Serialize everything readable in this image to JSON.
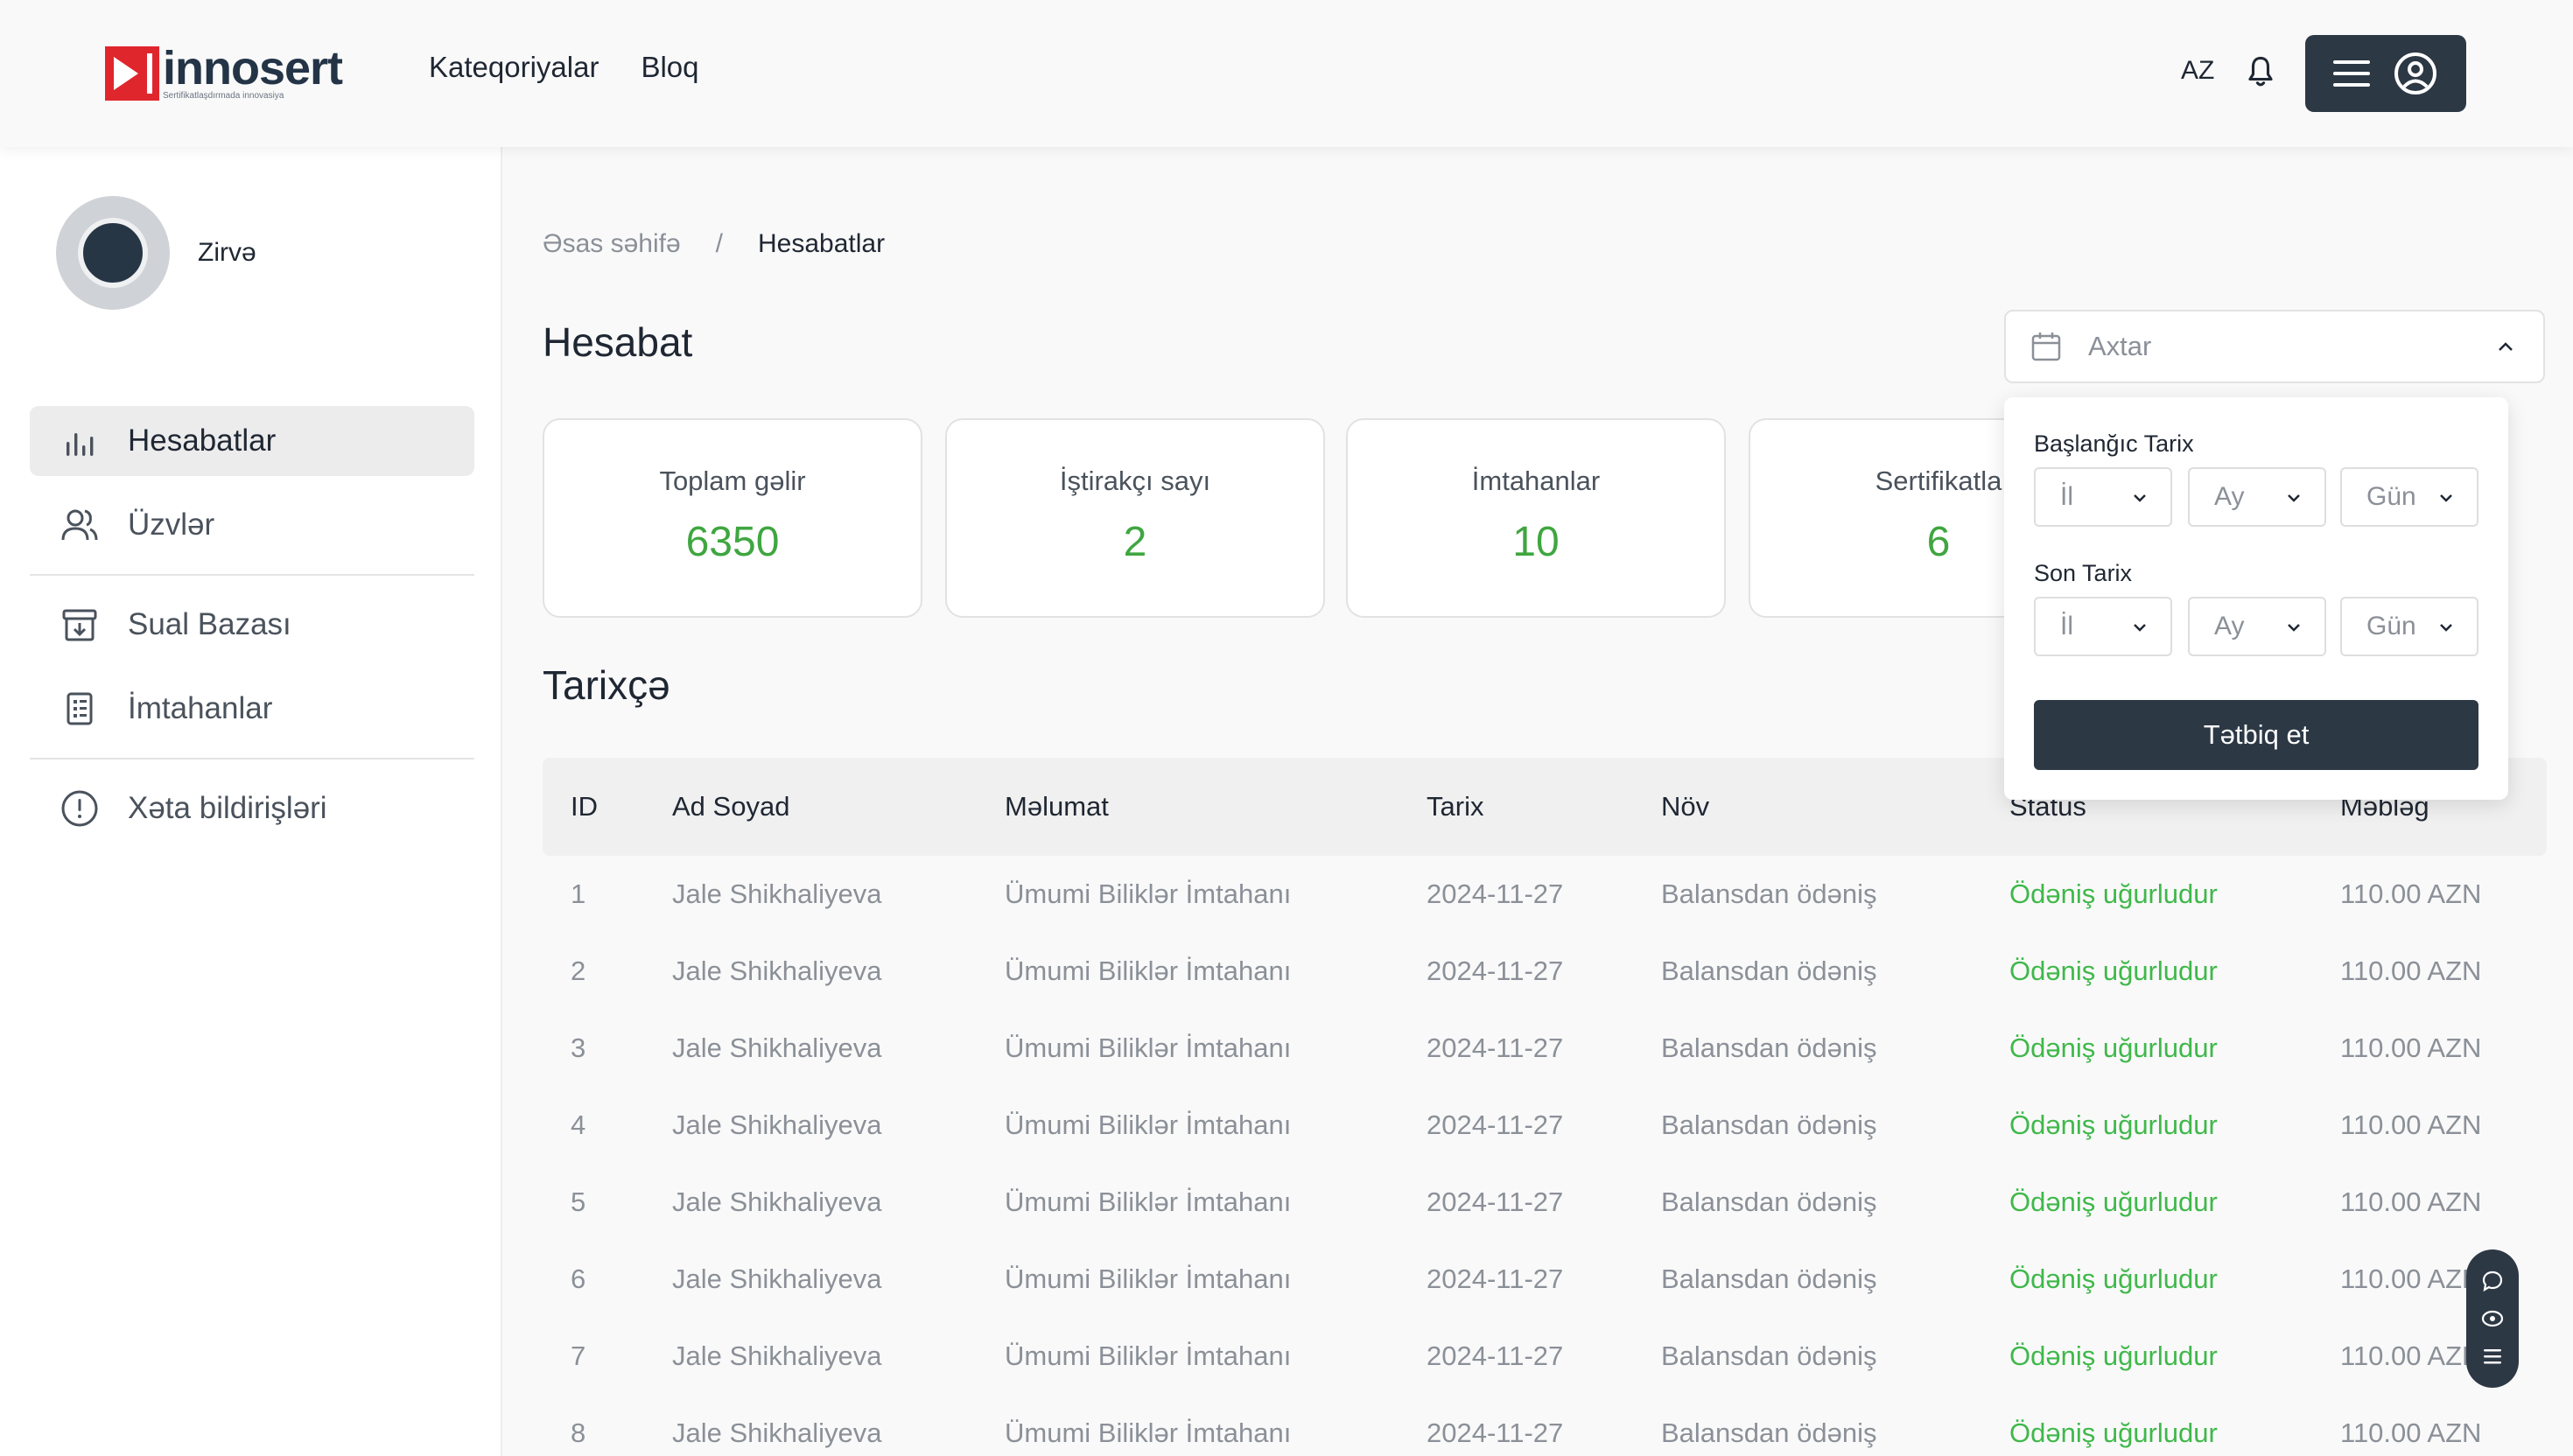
{
  "header": {
    "logo_word": "innosert",
    "logo_tagline": "Sertifikatlaşdırmada innovasiya",
    "nav": [
      "Kateqoriyalar",
      "Bloq"
    ],
    "lang": "AZ"
  },
  "sidebar": {
    "profile_name": "Zirvə",
    "items": [
      {
        "label": "Hesabatlar",
        "icon": "bar-chart-icon",
        "active": true
      },
      {
        "label": "Üzvlər",
        "icon": "users-icon"
      },
      {
        "label": "Sual Bazası",
        "icon": "archive-icon"
      },
      {
        "label": "İmtahanlar",
        "icon": "document-icon"
      },
      {
        "label": "Xəta bildirişləri",
        "icon": "alert-circle-icon"
      }
    ]
  },
  "breadcrumb": {
    "home": "Əsas səhifə",
    "sep": "/",
    "current": "Hesabatlar"
  },
  "page_title": "Hesabat",
  "search": {
    "placeholder": "Axtar"
  },
  "stats": [
    {
      "label": "Toplam gəlir",
      "value": "6350"
    },
    {
      "label": "İştirakçı sayı",
      "value": "2"
    },
    {
      "label": "İmtahanlar",
      "value": "10"
    },
    {
      "label": "Sertifikatla",
      "value": "6"
    }
  ],
  "history_title": "Tarixçə",
  "table": {
    "headers": [
      "ID",
      "Ad Soyad",
      "Məlumat",
      "Tarix",
      "Növ",
      "Status",
      "Məbləğ"
    ],
    "rows": [
      [
        "1",
        "Jale Shikhaliyeva",
        "Ümumi Biliklər İmtahanı",
        "2024-11-27",
        "Balansdan ödəniş",
        "Ödəniş uğurludur",
        "110.00 AZN"
      ],
      [
        "2",
        "Jale Shikhaliyeva",
        "Ümumi Biliklər İmtahanı",
        "2024-11-27",
        "Balansdan ödəniş",
        "Ödəniş uğurludur",
        "110.00 AZN"
      ],
      [
        "3",
        "Jale Shikhaliyeva",
        "Ümumi Biliklər İmtahanı",
        "2024-11-27",
        "Balansdan ödəniş",
        "Ödəniş uğurludur",
        "110.00 AZN"
      ],
      [
        "4",
        "Jale Shikhaliyeva",
        "Ümumi Biliklər İmtahanı",
        "2024-11-27",
        "Balansdan ödəniş",
        "Ödəniş uğurludur",
        "110.00 AZN"
      ],
      [
        "5",
        "Jale Shikhaliyeva",
        "Ümumi Biliklər İmtahanı",
        "2024-11-27",
        "Balansdan ödəniş",
        "Ödəniş uğurludur",
        "110.00 AZN"
      ],
      [
        "6",
        "Jale Shikhaliyeva",
        "Ümumi Biliklər İmtahanı",
        "2024-11-27",
        "Balansdan ödəniş",
        "Ödəniş uğurludur",
        "110.00 AZN"
      ],
      [
        "7",
        "Jale Shikhaliyeva",
        "Ümumi Biliklər İmtahanı",
        "2024-11-27",
        "Balansdan ödəniş",
        "Ödəniş uğurludur",
        "110.00 AZN"
      ],
      [
        "8",
        "Jale Shikhaliyeva",
        "Ümumi Biliklər İmtahanı",
        "2024-11-27",
        "Balansdan ödəniş",
        "Ödəniş uğurludur",
        "110.00 AZN"
      ]
    ]
  },
  "date_filter": {
    "start_label": "Başlanğıc Tarix",
    "end_label": "Son Tarix",
    "year": "İl",
    "month": "Ay",
    "day": "Gün",
    "apply": "Tətbiq et"
  },
  "colors": {
    "accent": "#2d3845",
    "success": "#3fb84a",
    "brand_red": "#e0262d"
  }
}
